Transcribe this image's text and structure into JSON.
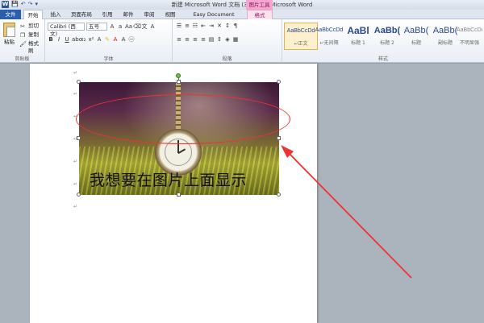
{
  "window": {
    "title": "新建 Microsoft Word 文档 (3).docx - Microsoft Word",
    "contextual_tab_group": "图片工具"
  },
  "quick_access": {
    "app_icon": "W",
    "save_icon": "save-icon",
    "undo_icon": "undo-icon",
    "redo_icon": "redo-icon"
  },
  "tabs": [
    {
      "label": "文件"
    },
    {
      "label": "开始"
    },
    {
      "label": "插入"
    },
    {
      "label": "页面布局"
    },
    {
      "label": "引用"
    },
    {
      "label": "邮件"
    },
    {
      "label": "审阅"
    },
    {
      "label": "视图"
    },
    {
      "label": "Easy Document Creator"
    },
    {
      "label": "格式"
    }
  ],
  "ribbon": {
    "clipboard": {
      "paste": "粘贴",
      "cut": "剪切",
      "copy": "复制",
      "format_painter": "格式刷",
      "label": "剪贴板"
    },
    "font": {
      "font_name": "Calibri (西文)",
      "font_size": "五号",
      "label": "字体"
    },
    "paragraph": {
      "label": "段落"
    },
    "styles": {
      "items": [
        {
          "sample": "AaBbCcDd",
          "name": "↵正文"
        },
        {
          "sample": "AaBbCcDd",
          "name": "↵无间隔"
        },
        {
          "sample": "AaBl",
          "name": "标题 1"
        },
        {
          "sample": "AaBb(",
          "name": "标题 2"
        },
        {
          "sample": "AaBb(",
          "name": "标题"
        },
        {
          "sample": "AaBb(",
          "name": "副标题"
        },
        {
          "sample": "AaBbCcDd",
          "name": "不明显强"
        }
      ],
      "label": "样式"
    }
  },
  "document": {
    "overlay_text": "我想要在图片上面显示",
    "paragraph_mark": "↵"
  },
  "colors": {
    "annotation": "#e33333",
    "file_tab": "#2b5fae",
    "format_tab": "#f4a6d0"
  }
}
